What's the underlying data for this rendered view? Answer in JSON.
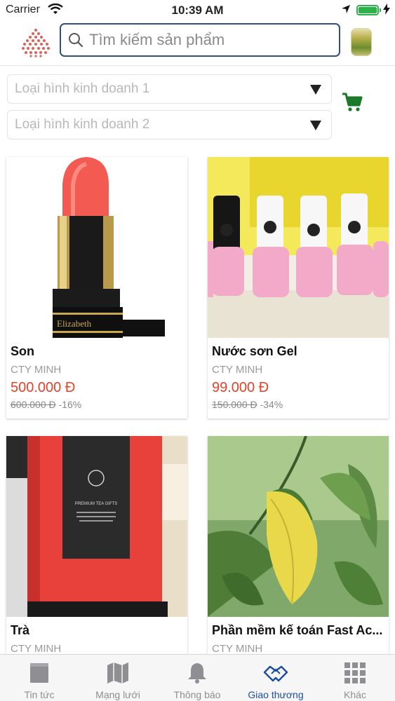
{
  "status_bar": {
    "carrier": "Carrier",
    "time": "10:39 AM"
  },
  "search": {
    "placeholder": "Tìm kiếm sản phẩm"
  },
  "filters": [
    {
      "label": "Loại hình kinh doanh 1"
    },
    {
      "label": "Loại hình kinh doanh 2"
    }
  ],
  "products": [
    {
      "name": "Son",
      "seller": "CTY MINH",
      "price": "500.000 Đ",
      "old_price": "600.000 Đ",
      "discount": "-16%"
    },
    {
      "name": "Nước sơn Gel",
      "seller": "CTY MINH",
      "price": "99.000 Đ",
      "old_price": "150.000 Đ",
      "discount": "-34%"
    },
    {
      "name": "Trà",
      "seller": "CTY MINH"
    },
    {
      "name": "Phần mềm kế  toán Fast Ac...",
      "seller": "CTY MINH"
    }
  ],
  "product_image_text": {
    "lipstick_brand": "Elizabeth",
    "tea_box_text": "PREMIUM TEA GIFTS"
  },
  "tabs": [
    {
      "label": "Tin tức",
      "icon": "news-icon"
    },
    {
      "label": "Mạng lưới",
      "icon": "map-icon"
    },
    {
      "label": "Thông báo",
      "icon": "bell-icon"
    },
    {
      "label": "Giao thương",
      "icon": "handshake-icon",
      "active": true
    },
    {
      "label": "Khác",
      "icon": "grid-icon"
    }
  ],
  "colors": {
    "accent": "#1d4e9c",
    "price": "#e8412a",
    "cart": "#1a7a2a",
    "battery": "#2bb34a"
  }
}
